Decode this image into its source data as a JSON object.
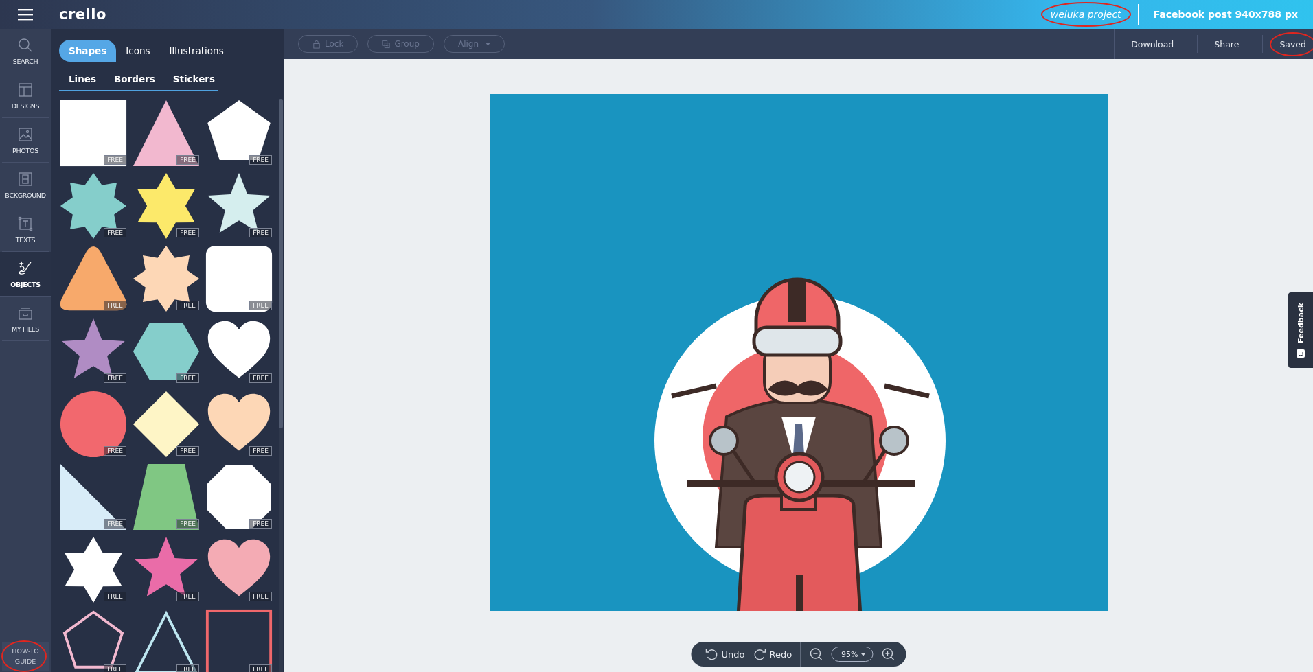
{
  "header": {
    "logo": "crello",
    "project_name": "weluka project",
    "format": "Facebook post 940x788 px"
  },
  "sidebar": {
    "items": [
      {
        "label": "SEARCH",
        "selected": false
      },
      {
        "label": "DESIGNS",
        "selected": false
      },
      {
        "label": "PHOTOS",
        "selected": false
      },
      {
        "label": "BCKGROUND",
        "selected": false
      },
      {
        "label": "TEXTS",
        "selected": false
      },
      {
        "label": "OBJECTS",
        "selected": true
      },
      {
        "label": "MY FILES",
        "selected": false
      }
    ],
    "guide": "HOW-TO GUIDE"
  },
  "panel": {
    "tabs": [
      {
        "label": "Shapes",
        "selected": true
      },
      {
        "label": "Icons",
        "selected": false
      },
      {
        "label": "Illustrations",
        "selected": false
      }
    ],
    "subtabs": [
      "Lines",
      "Borders",
      "Stickers"
    ],
    "shapes": [
      {
        "kind": "square",
        "color": "#ffffff",
        "badge": "FREE"
      },
      {
        "kind": "triangle",
        "color": "#f2b8cf",
        "badge": "FREE"
      },
      {
        "kind": "pentagon",
        "color": "#ffffff",
        "badge": "FREE"
      },
      {
        "kind": "octagram",
        "color": "#85cecb",
        "badge": "FREE"
      },
      {
        "kind": "hexagram",
        "color": "#fce96a",
        "badge": "FREE"
      },
      {
        "kind": "star",
        "color": "#d5eeee",
        "badge": "FREE"
      },
      {
        "kind": "rounded-triangle",
        "color": "#f7a96b",
        "badge": "FREE"
      },
      {
        "kind": "octagram",
        "color": "#fdd7b6",
        "badge": "FREE"
      },
      {
        "kind": "rounded-square",
        "color": "#ffffff",
        "badge": "FREE"
      },
      {
        "kind": "star",
        "color": "#b08cc4",
        "badge": "FREE"
      },
      {
        "kind": "hexagon",
        "color": "#85cecb",
        "badge": "FREE"
      },
      {
        "kind": "heart",
        "color": "#ffffff",
        "badge": "FREE"
      },
      {
        "kind": "circle",
        "color": "#f2686e",
        "badge": "FREE"
      },
      {
        "kind": "diamond",
        "color": "#fef5c6",
        "badge": "FREE"
      },
      {
        "kind": "heart",
        "color": "#fdd7b6",
        "badge": "FREE"
      },
      {
        "kind": "right-triangle",
        "color": "#d8ecf8",
        "badge": "FREE"
      },
      {
        "kind": "trapezoid",
        "color": "#80c783",
        "badge": "FREE"
      },
      {
        "kind": "octagon",
        "color": "#ffffff",
        "badge": "FREE"
      },
      {
        "kind": "hexagram",
        "color": "#ffffff",
        "badge": "FREE"
      },
      {
        "kind": "star",
        "color": "#ea6ca8",
        "badge": "FREE"
      },
      {
        "kind": "heart",
        "color": "#f4abb4",
        "badge": "FREE"
      },
      {
        "kind": "pentagon-outline",
        "color": "#f2b8cf",
        "badge": "FREE"
      },
      {
        "kind": "triangle-outline",
        "color": "#bde6f0",
        "badge": "FREE"
      },
      {
        "kind": "square-outline",
        "color": "#f0676b",
        "badge": "FREE"
      }
    ]
  },
  "toolbar": {
    "buttons": [
      {
        "label": "Lock",
        "disabled": true
      },
      {
        "label": "Group",
        "disabled": true
      },
      {
        "label": "Align",
        "disabled": true
      }
    ],
    "actions": [
      {
        "label": "Download",
        "selected": false
      },
      {
        "label": "Share",
        "selected": false
      },
      {
        "label": "Saved",
        "selected": false
      }
    ]
  },
  "footer": {
    "undo": "Undo",
    "redo": "Redo",
    "zoom": "95%"
  },
  "feedback": "Feedback"
}
